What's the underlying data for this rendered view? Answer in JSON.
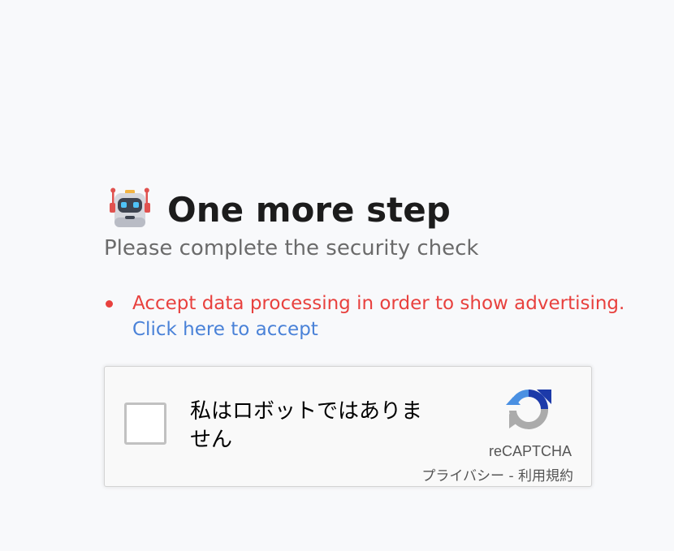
{
  "heading": {
    "icon": "robot-icon",
    "title": "One more step",
    "subtitle": "Please complete the security check"
  },
  "notice": {
    "message": "Accept data processing in order to show advertising.",
    "link_text": "Click here to accept",
    "message_color": "#e8413e",
    "link_color": "#4a82d8"
  },
  "captcha": {
    "checkbox_label": "私はロボットではありません",
    "brand": "reCAPTCHA",
    "privacy_link": "プライバシー",
    "separator": " - ",
    "terms_link": "利用規約",
    "logo_icon": "recaptcha-logo-icon"
  }
}
